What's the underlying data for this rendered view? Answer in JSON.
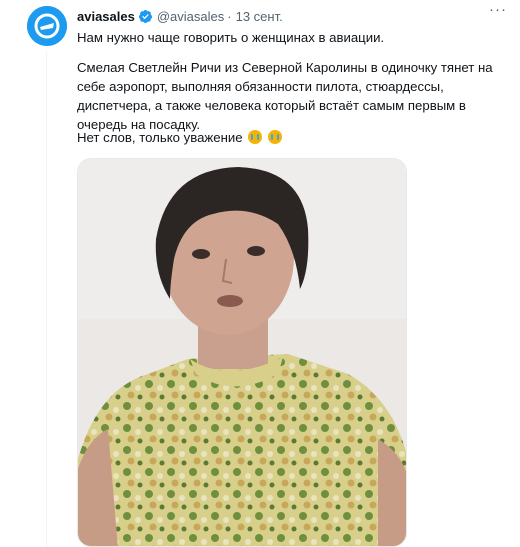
{
  "tweet": {
    "display_name": "aviasales",
    "handle": "@aviasales",
    "separator": "·",
    "date": "13 сент.",
    "more_label": "···",
    "line1": "Нам нужно чаще говорить о женщинах в авиации.",
    "line2": "Смелая Светлейн Ричи из Северной Каролины в одиночку тянет на себе аэропорт, выполняя обязанности пилота, стюардессы, диспетчера, а также человека который встаёт самым первым в очередь на посадку.",
    "line3": "Нет слов, только уважение",
    "emojis": [
      "loudly-crying-face-icon",
      "loudly-crying-face-icon"
    ]
  },
  "colors": {
    "avatar_bg": "#1d9bf0",
    "verified": "#1d9bf0",
    "text": "#0f1419",
    "muted": "#536471"
  }
}
